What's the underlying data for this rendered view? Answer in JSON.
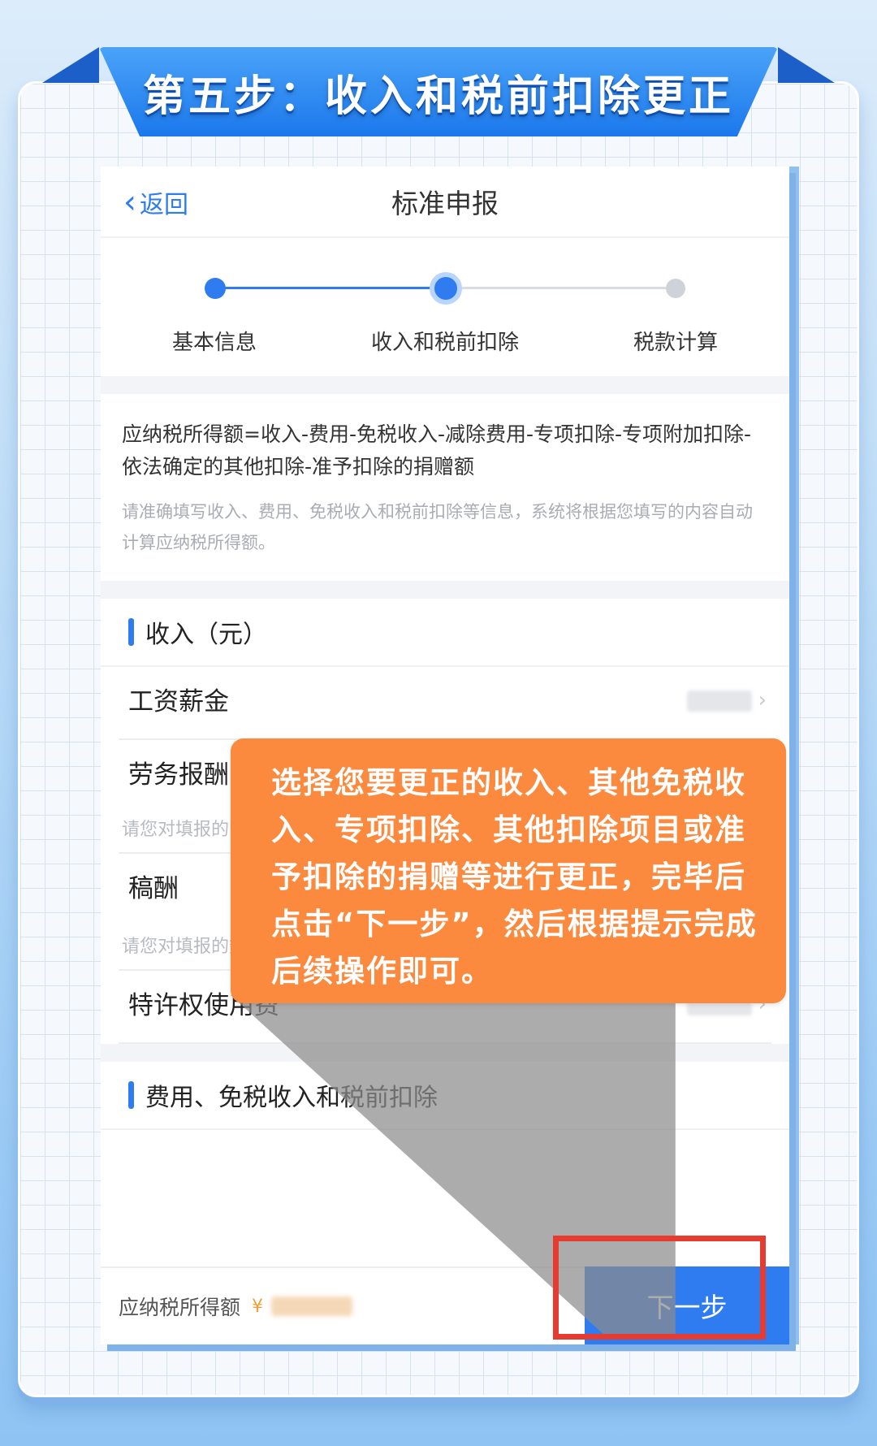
{
  "banner": {
    "title": "第五步：收入和税前扣除更正"
  },
  "nav": {
    "back_label": "返回",
    "title": "标准申报"
  },
  "steps": [
    {
      "label": "基本信息",
      "state": "done"
    },
    {
      "label": "收入和税前扣除",
      "state": "current"
    },
    {
      "label": "税款计算",
      "state": "pending"
    }
  ],
  "formula": {
    "text": "应纳税所得额=收入-费用-免税收入-减除费用-专项扣除-专项附加扣除-依法确定的其他扣除-准予扣除的捐赠额",
    "hint": "请准确填写收入、费用、免税收入和税前扣除等信息，系统将根据您填写的内容自动计算应纳税所得额。"
  },
  "income_section": {
    "title": "收入（元）",
    "items": [
      {
        "label": "工资薪金",
        "hint": ""
      },
      {
        "label": "劳务报酬",
        "hint": "请您对填报的"
      },
      {
        "label": "稿酬",
        "hint": "请您对填报的数据认真核实"
      },
      {
        "label": "特许权使用费",
        "hint": ""
      }
    ]
  },
  "deduction_section": {
    "title": "费用、免税收入和税前扣除"
  },
  "bottom": {
    "taxable_label": "应纳税所得额",
    "currency": "¥",
    "next_label": "下一步"
  },
  "callout": {
    "text": "选择您要更正的收入、其他免税收入、专项扣除、其他扣除项目或准予扣除的捐赠等进行更正，完毕后点击“下一步”，然后根据提示完成后续操作即可。"
  },
  "colors": {
    "accent": "#2f7bf0",
    "callout": "#fb8a3e",
    "highlight": "#e53b30",
    "banner": "#1c78ec"
  }
}
